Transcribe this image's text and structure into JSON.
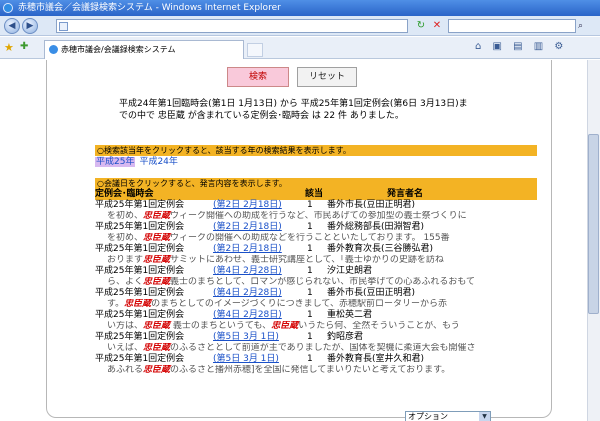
{
  "window": {
    "title": "赤穂市議会／会議録検索システム - Windows Internet Explorer"
  },
  "tab": {
    "label": "赤穂市議会/会議録検索システム"
  },
  "nav": {
    "back_icon": "◀",
    "forward_icon": "▶",
    "refresh_icon": "↻",
    "stop_icon": "✕",
    "search_go_icon": "⌕"
  },
  "toolbar": {
    "tools_icons": "⌂ ▣ ▤ ▥ ⚙"
  },
  "buttons": {
    "search_label": "検索",
    "reset_label": "リセット"
  },
  "summary": "平成24年第1回臨時会(第1日 1月13日) から 平成25年第1回定例会(第6日 3月13日)までの中で 忠臣蔵 が含まれている定例会･臨時会 は 22 件 ありました。",
  "year_instruction": "○検索該当年をクリックすると、該当する年の検索結果を表示します。",
  "years": [
    "平成25年",
    "平成24年"
  ],
  "meeting_instruction": "○会議日をクリックすると、発言内容を表示します。",
  "headers": {
    "meeting": "定例会･臨時会",
    "no": "該当",
    "speaker": "発言者名"
  },
  "keyword": "忠臣蔵",
  "results": [
    {
      "meeting": "平成25年第1回定例会",
      "date": "(第2日 2月18日)",
      "no": "1",
      "speaker": "番外市長(豆田正明君)",
      "pre": "を初め、",
      "post": "ウィーク開催への助成を行うなど、市民あげての参加型の義士祭づくりに"
    },
    {
      "meeting": "平成25年第1回定例会",
      "date": "(第2日 2月18日)",
      "no": "1",
      "speaker": "番外総務部長(田淵智君)",
      "pre": "を初め、",
      "post": "ウィークの開催への助成などを行うことといたしております。 155番"
    },
    {
      "meeting": "平成25年第1回定例会",
      "date": "(第2日 2月18日)",
      "no": "1",
      "speaker": "番外教育次長(三谷勝弘君)",
      "pre": "おります",
      "post": "サミットにあわせ、義士研究講座として、「義士ゆかりの史跡を訪ね"
    },
    {
      "meeting": "平成25年第1回定例会",
      "date": "(第4日 2月28日)",
      "no": "1",
      "speaker": "汐江史朗君",
      "pre": "ら、よく",
      "post": "義士のまちとして、ロマンが感じられない、市民挙げての心あふれるおもて"
    },
    {
      "meeting": "平成25年第1回定例会",
      "date": "(第4日 2月28日)",
      "no": "1",
      "speaker": "番外市長(豆田正明君)",
      "pre": "す。",
      "post": "のまちとしてのイメージづくりにつきまして、赤穂駅前ロータリーから赤"
    },
    {
      "meeting": "平成25年第1回定例会",
      "date": "(第4日 2月28日)",
      "no": "1",
      "speaker": "重松英二君",
      "pre": "い方は、",
      "post": " 義士のまちというても、",
      "pre2": "",
      "post2": "いうたら何、全然そういうことが、もう"
    },
    {
      "meeting": "平成25年第1回定例会",
      "date": "(第5日 3月 1日)",
      "no": "1",
      "speaker": "釣昭彦君",
      "pre": "いえば、",
      "post": "のふるさととして前道が主でありましたが、国体を契機に柔道大会も開催さ"
    },
    {
      "meeting": "平成25年第1回定例会",
      "date": "(第5日 3月 1日)",
      "no": "1",
      "speaker": "番外教育長(室井久和君)",
      "pre": "あふれる",
      "post": "のふるさと播州赤穂]を全国に発信してまいりたいと考えております。"
    }
  ],
  "option_select": {
    "value": "オプション"
  },
  "colors": {
    "accent_bar": "#f3b324",
    "keyword": "#d40000",
    "link": "#1a50c8",
    "search_button_bg": "#f9c9da"
  }
}
